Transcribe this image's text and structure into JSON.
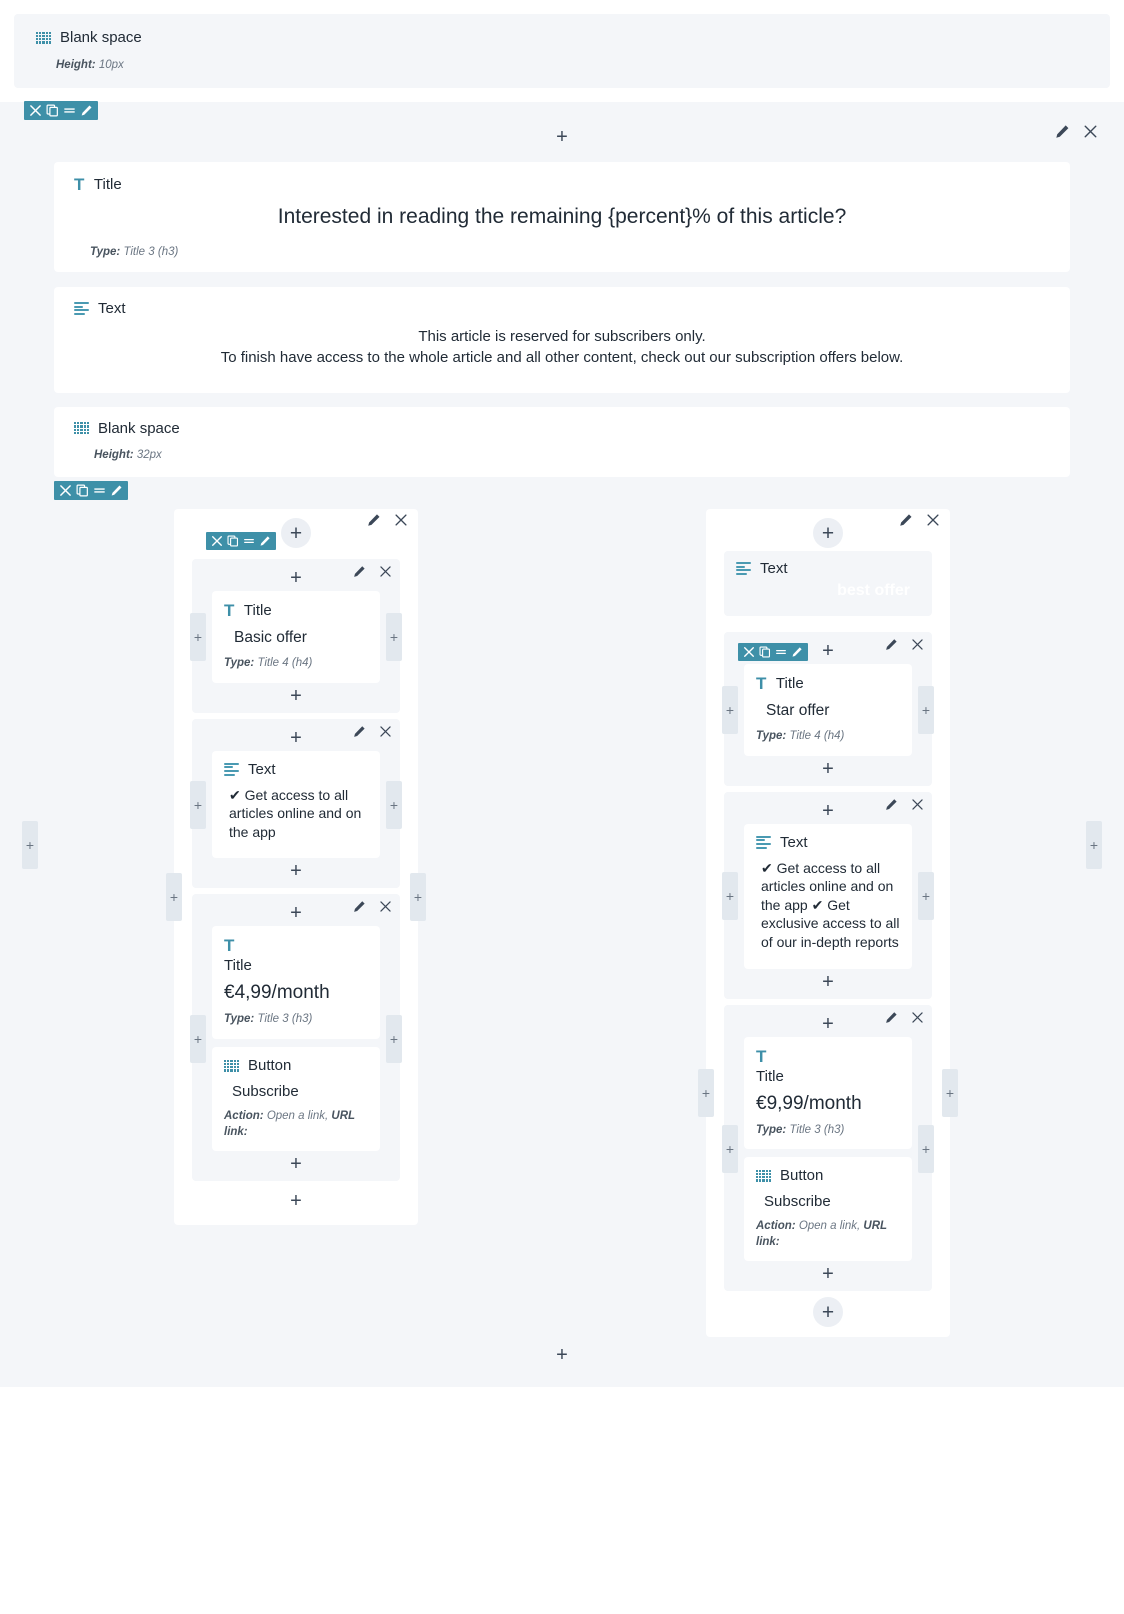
{
  "icons": {
    "close": "close-icon",
    "duplicate": "duplicate-icon",
    "move": "move-handle-icon",
    "edit": "pencil-icon",
    "add": "+",
    "grid": "grid-icon",
    "text_lines": "text-lines-icon",
    "title_t": "T"
  },
  "top_blank_space": {
    "label": "Blank space",
    "meta_key": "Height:",
    "meta_value": "10px"
  },
  "section": {
    "title_block": {
      "label": "Title",
      "content": "Interested in reading the remaining {percent}% of this article?",
      "meta_key": "Type:",
      "meta_value": "Title 3 (h3)"
    },
    "text_block": {
      "label": "Text",
      "line1": "This article is reserved for subscribers only.",
      "line2": "To finish have access to the whole article and all other content, check out our subscription offers below."
    },
    "blank_space": {
      "label": "Blank space",
      "meta_key": "Height:",
      "meta_value": "32px"
    }
  },
  "offers": [
    {
      "name": "basic-offer",
      "title_block": {
        "label": "Title",
        "content": "Basic offer",
        "meta_key": "Type:",
        "meta_value": "Title 4 (h4)"
      },
      "features_block": {
        "label": "Text",
        "content": "✔ Get access to all articles online and on the app"
      },
      "price_block": {
        "label": "Title",
        "content": "€4,99/month",
        "meta_key": "Type:",
        "meta_value": "Title 3 (h3)"
      },
      "button_block": {
        "label": "Button",
        "content": "Subscribe",
        "meta_action_key": "Action:",
        "meta_action_value": "Open a link,",
        "meta_url_key": "URL link:"
      }
    },
    {
      "name": "star-offer",
      "badge_block": {
        "label": "Text",
        "content": "best offer"
      },
      "title_block": {
        "label": "Title",
        "content": "Star offer",
        "meta_key": "Type:",
        "meta_value": "Title 4 (h4)"
      },
      "features_block": {
        "label": "Text",
        "content": "✔ Get access to all articles online and on the app ✔ Get exclusive access to all of our in-depth reports"
      },
      "price_block": {
        "label": "Title",
        "content": "€9,99/month",
        "meta_key": "Type:",
        "meta_value": "Title 3 (h3)"
      },
      "button_block": {
        "label": "Button",
        "content": "Subscribe",
        "meta_action_key": "Action:",
        "meta_action_value": "Open a link,",
        "meta_url_key": "URL link:"
      }
    }
  ],
  "colors": {
    "accent": "#3e90a8",
    "panel": "#f4f6f9",
    "card": "#ffffff",
    "text": "#212b36",
    "muted": "#6b7683",
    "side_tab": "#e2e8ee"
  }
}
